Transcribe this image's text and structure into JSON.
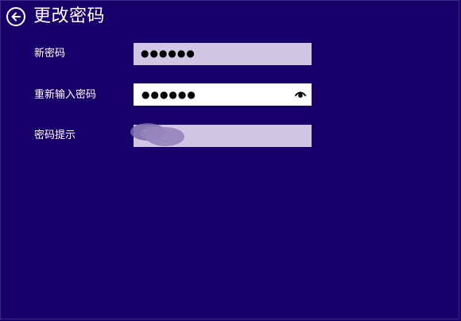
{
  "header": {
    "title": "更改密码",
    "back_icon": "back-arrow-circle-icon"
  },
  "fields": [
    {
      "label": "新密码",
      "value": "●●●●●●",
      "state": "inactive"
    },
    {
      "label": "重新输入密码",
      "value": "●●●●●●",
      "state": "active",
      "reveal_icon": "eye-icon"
    },
    {
      "label": "密码提示",
      "value": "",
      "state": "inactive",
      "obscured": true
    }
  ],
  "colors": {
    "background": "#18006a",
    "field_inactive": "#d0c8e2",
    "field_active": "#ffffff"
  }
}
